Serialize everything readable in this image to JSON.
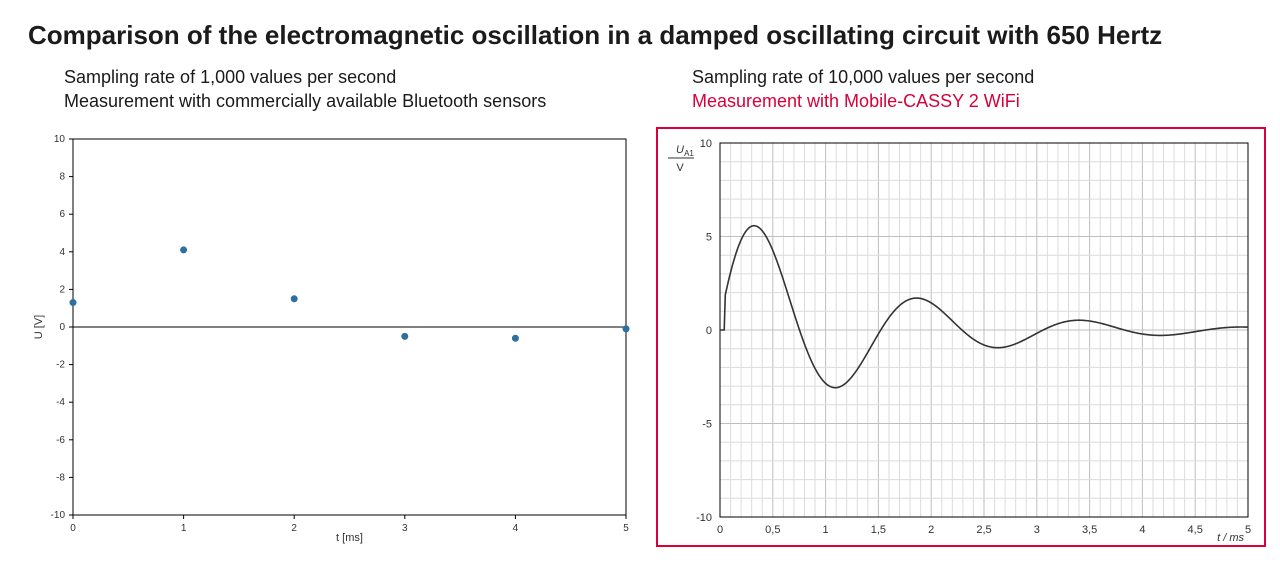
{
  "title": "Comparison of the electromagnetic oscillation in a damped oscillating circuit with 650 Hertz",
  "left": {
    "sub1": "Sampling rate of 1,000 values per second",
    "sub2": "Measurement with commercially available Bluetooth sensors"
  },
  "right": {
    "sub1": "Sampling rate of 10,000 values per second",
    "sub2": "Measurement with Mobile-CASSY 2 WiFi"
  },
  "chart_data": [
    {
      "type": "scatter",
      "xlabel": "t [ms]",
      "ylabel": "U [V]",
      "xlim": [
        0,
        5
      ],
      "ylim": [
        -10,
        10
      ],
      "xticks": [
        0,
        1,
        2,
        3,
        4,
        5
      ],
      "yticks": [
        -10,
        -8,
        -6,
        -4,
        -2,
        0,
        2,
        4,
        6,
        8,
        10
      ],
      "x": [
        0.0,
        1.0,
        2.0,
        3.0,
        4.0,
        5.0
      ],
      "y": [
        1.3,
        4.1,
        1.5,
        -0.5,
        -0.6,
        -0.1
      ],
      "zero_line_at_y": 0,
      "point_color": "#2e6fa0"
    },
    {
      "type": "line",
      "xlabel": "t / ms",
      "ylabel_frac": {
        "top": "U",
        "sub": "A1",
        "bottom": "V"
      },
      "xlim": [
        0,
        5
      ],
      "ylim": [
        -10,
        10
      ],
      "xticks": [
        0,
        0.5,
        1,
        1.5,
        2,
        2.5,
        3,
        3.5,
        4,
        4.5,
        5
      ],
      "xtick_labels": [
        "0",
        "0,5",
        "1",
        "1,5",
        "2",
        "2,5",
        "3",
        "3,5",
        "4",
        "4,5",
        "5"
      ],
      "yticks": [
        -10,
        -5,
        0,
        5,
        10
      ],
      "ytick_labels": [
        "-10",
        "-5",
        "0",
        "5",
        "10"
      ],
      "curve": {
        "model": "damped_cosine",
        "start_t_ms": 0.05,
        "initial_amplitude_V": 7.0,
        "decay_tau_ms": 1.3,
        "frequency_Hz": 650,
        "phase_rad": -1.3
      },
      "line_color": "#333333"
    }
  ]
}
